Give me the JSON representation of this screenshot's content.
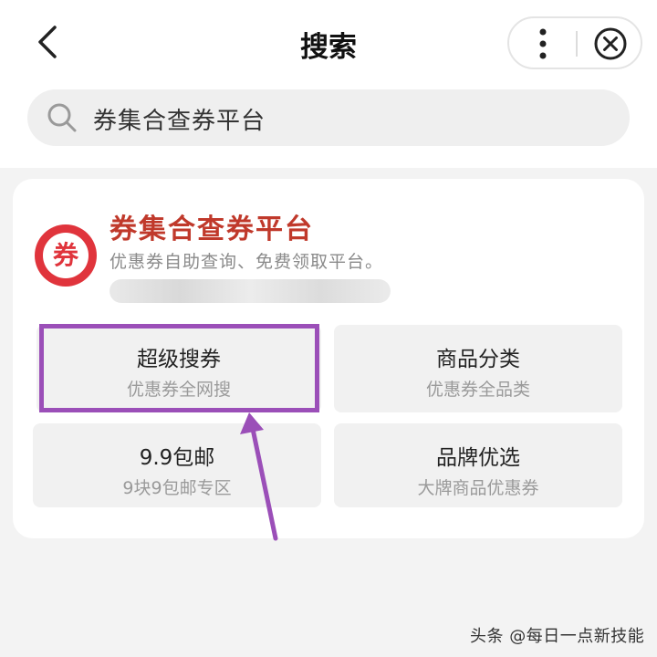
{
  "header": {
    "title": "搜索",
    "back_icon": "chevron-left-icon",
    "more_icon": "more-vertical-icon",
    "close_icon": "close-circle-icon"
  },
  "search": {
    "value": "券集合查券平台",
    "icon": "search-icon"
  },
  "result": {
    "logo_char": "券",
    "name": "券集合查券平台",
    "description": "优惠券自助查询、免费领取平台。",
    "accent_color": "#e0343c",
    "tiles": [
      {
        "title": "超级搜券",
        "subtitle": "优惠券全网搜"
      },
      {
        "title": "商品分类",
        "subtitle": "优惠券全品类"
      },
      {
        "title": "9.9包邮",
        "subtitle": "9块9包邮专区"
      },
      {
        "title": "品牌优选",
        "subtitle": "大牌商品优惠券"
      }
    ]
  },
  "annotation": {
    "highlight_color": "#9b4fb8"
  },
  "watermark": "头条 @每日一点新技能"
}
